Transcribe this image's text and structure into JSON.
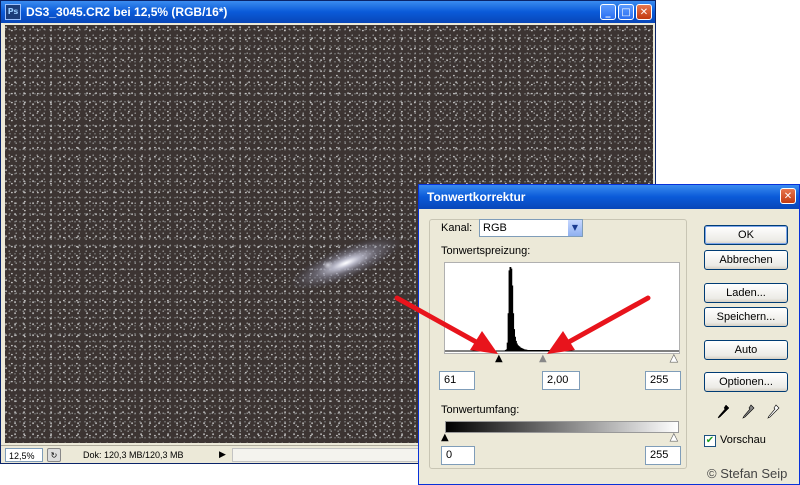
{
  "image_window": {
    "title": "DS3_3045.CR2 bei 12,5% (RGB/16*)",
    "app_icon": "Ps",
    "controls": {
      "minimize": "_",
      "maximize": "□",
      "close": "✕"
    },
    "status": {
      "zoom": "12,5%",
      "doc_info": "Dok: 120,3 MB/120,3 MB",
      "arrow": "▶",
      "icon": "status-cycle-icon"
    }
  },
  "dialog": {
    "title": "Tonwertkorrektur",
    "channel_label": "Kanal:",
    "channel_value": "RGB",
    "input_levels_label": "Tonwertspreizung:",
    "input_black": "61",
    "input_gamma": "2,00",
    "input_white": "255",
    "output_levels_label": "Tonwertumfang:",
    "output_black": "0",
    "output_white": "255",
    "buttons": {
      "ok": "OK",
      "cancel": "Abbrechen",
      "load": "Laden...",
      "save": "Speichern...",
      "auto": "Auto",
      "options": "Optionen..."
    },
    "preview_label": "Vorschau",
    "preview_checked": true,
    "copyright": "© Stefan Seip"
  },
  "histogram": {
    "levels": [
      0,
      0,
      0,
      0,
      0,
      0,
      0,
      0,
      0,
      0,
      0,
      0,
      0,
      0,
      0,
      0,
      0,
      0,
      0,
      0,
      0,
      0,
      0,
      0,
      0,
      0,
      0,
      0,
      0,
      0,
      0,
      0,
      0,
      0,
      0,
      0,
      0,
      0,
      0,
      0,
      0,
      0,
      0,
      0,
      0,
      0,
      0,
      0,
      0,
      0,
      0,
      0,
      0,
      0,
      0,
      0,
      0,
      0,
      0,
      0,
      0,
      0,
      0,
      0,
      0,
      0.01,
      0.02,
      0.1,
      0.45,
      0.96,
      1.0,
      1.0,
      0.98,
      0.78,
      0.45,
      0.26,
      0.17,
      0.12,
      0.09,
      0.07,
      0.06,
      0.05,
      0.04,
      0.035,
      0.03,
      0.025,
      0.02,
      0.018,
      0.016,
      0.014,
      0.012,
      0.01,
      0.008,
      0.007,
      0.006,
      0.005,
      0.004,
      0.004,
      0.003,
      0.003,
      0.003,
      0.002,
      0.002,
      0.002,
      0.002,
      0.002,
      0.001,
      0.001,
      0.001,
      0.001,
      0.001,
      0.001,
      0.001,
      0.001,
      0.001,
      0.001,
      0.001,
      0.001,
      0.001,
      0.001,
      0.001,
      0.001,
      0.001,
      0.001,
      0.001,
      0.001,
      0,
      0,
      0,
      0,
      0,
      0,
      0,
      0,
      0,
      0,
      0,
      0,
      0,
      0,
      0,
      0,
      0,
      0,
      0,
      0,
      0,
      0,
      0,
      0,
      0,
      0,
      0,
      0,
      0,
      0,
      0,
      0,
      0,
      0,
      0,
      0,
      0,
      0,
      0,
      0,
      0,
      0,
      0,
      0,
      0,
      0,
      0,
      0,
      0,
      0,
      0,
      0,
      0,
      0,
      0,
      0,
      0,
      0,
      0,
      0,
      0,
      0,
      0,
      0,
      0,
      0,
      0,
      0,
      0,
      0,
      0,
      0,
      0,
      0,
      0,
      0,
      0,
      0,
      0,
      0,
      0,
      0,
      0,
      0,
      0,
      0,
      0,
      0,
      0,
      0,
      0,
      0,
      0,
      0,
      0,
      0,
      0,
      0,
      0,
      0,
      0,
      0,
      0,
      0,
      0,
      0,
      0,
      0,
      0,
      0,
      0,
      0,
      0,
      0,
      0,
      0,
      0,
      0,
      0,
      0,
      0,
      0,
      0,
      0,
      0,
      0,
      0,
      0
    ]
  },
  "colors": {
    "annotation_arrow": "#e8141c",
    "titlebar": "#0a5ad8"
  }
}
